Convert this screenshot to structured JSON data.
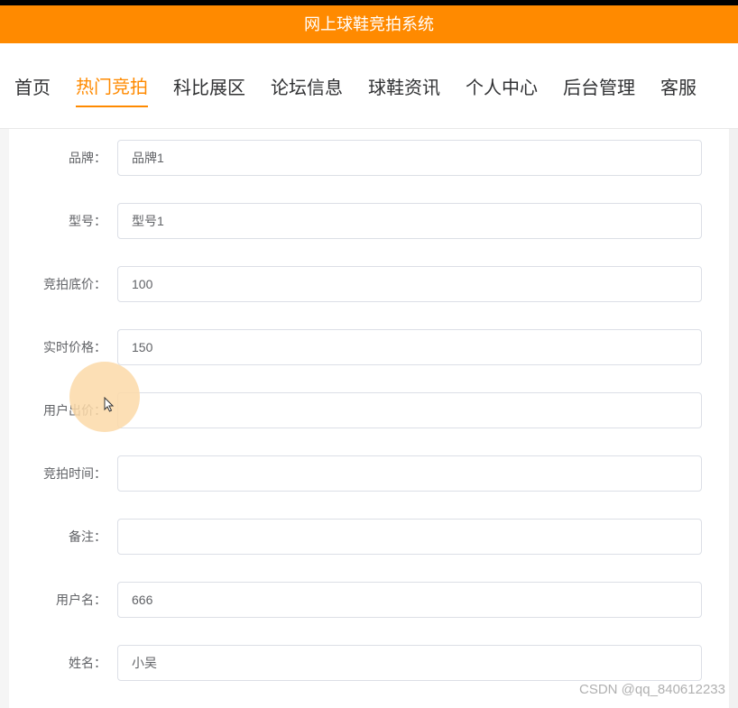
{
  "header": {
    "title": "网上球鞋竞拍系统"
  },
  "nav": {
    "items": [
      {
        "label": "首页",
        "active": false
      },
      {
        "label": "热门竞拍",
        "active": true
      },
      {
        "label": "科比展区",
        "active": false
      },
      {
        "label": "论坛信息",
        "active": false
      },
      {
        "label": "球鞋资讯",
        "active": false
      },
      {
        "label": "个人中心",
        "active": false
      },
      {
        "label": "后台管理",
        "active": false
      },
      {
        "label": "客服",
        "active": false
      }
    ]
  },
  "form": {
    "brand": {
      "label": "品牌：",
      "value": "品牌1"
    },
    "model": {
      "label": "型号：",
      "value": "型号1"
    },
    "base_price": {
      "label": "竞拍底价：",
      "value": "100"
    },
    "real_price": {
      "label": "实时价格：",
      "value": "150"
    },
    "user_bid": {
      "label": "用户出价：",
      "value": ""
    },
    "bid_time": {
      "label": "竞拍时间：",
      "value": ""
    },
    "remark": {
      "label": "备注：",
      "value": ""
    },
    "username": {
      "label": "用户名：",
      "value": "666"
    },
    "name": {
      "label": "姓名：",
      "value": "小吴"
    }
  },
  "watermark": "CSDN @qq_840612233"
}
